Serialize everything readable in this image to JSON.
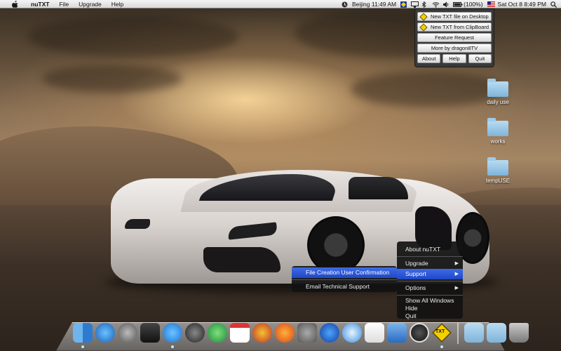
{
  "menubar": {
    "app_name": "nuTXT",
    "menus": [
      "File",
      "Upgrade",
      "Help"
    ],
    "clock_city": "Beijing 11:49 AM",
    "battery": "(100%)",
    "datetime": "Sat Oct 8   8:49 PM"
  },
  "nutxt_panel": {
    "new_desktop": "New TXT file on Desktop",
    "new_clipboard": "New TXT from ClipBoard",
    "feature_request": "Feature Request",
    "more_by": "More by dragon8TV",
    "about": "About",
    "help": "Help",
    "quit": "Quit"
  },
  "desktop": {
    "folders": [
      "daily use",
      "works",
      "tempUSE"
    ]
  },
  "dock_menu": {
    "about": "About  nuTXT",
    "upgrade": "Upgrade",
    "support": "Support",
    "options": "Options",
    "show_all": "Show All Windows",
    "hide": "Hide",
    "quit": "Quit"
  },
  "support_submenu": {
    "file_creation": "File Creation User Confirmation",
    "email_support": "Email Technical Support"
  },
  "dock": {
    "badge": "TXT",
    "items": [
      "finder-icon",
      "itunes-icon",
      "launchpad-icon",
      "dashboard-icon",
      "app-store-icon",
      "chrome-like-icon",
      "messenger-icon",
      "calendar-icon",
      "app-icon",
      "firefox-icon",
      "system-preferences-icon",
      "google-earth-icon",
      "safari-icon",
      "textedit-icon",
      "xcode-icon",
      "zip-icon",
      "nutxt-icon",
      "applications-folder-icon",
      "documents-folder-icon",
      "trash-icon"
    ]
  },
  "colors": {
    "menu_highlight": "#2f5bd8",
    "nutxt_diamond": "#f5d000",
    "folder_blue": "#8ec2e6"
  }
}
